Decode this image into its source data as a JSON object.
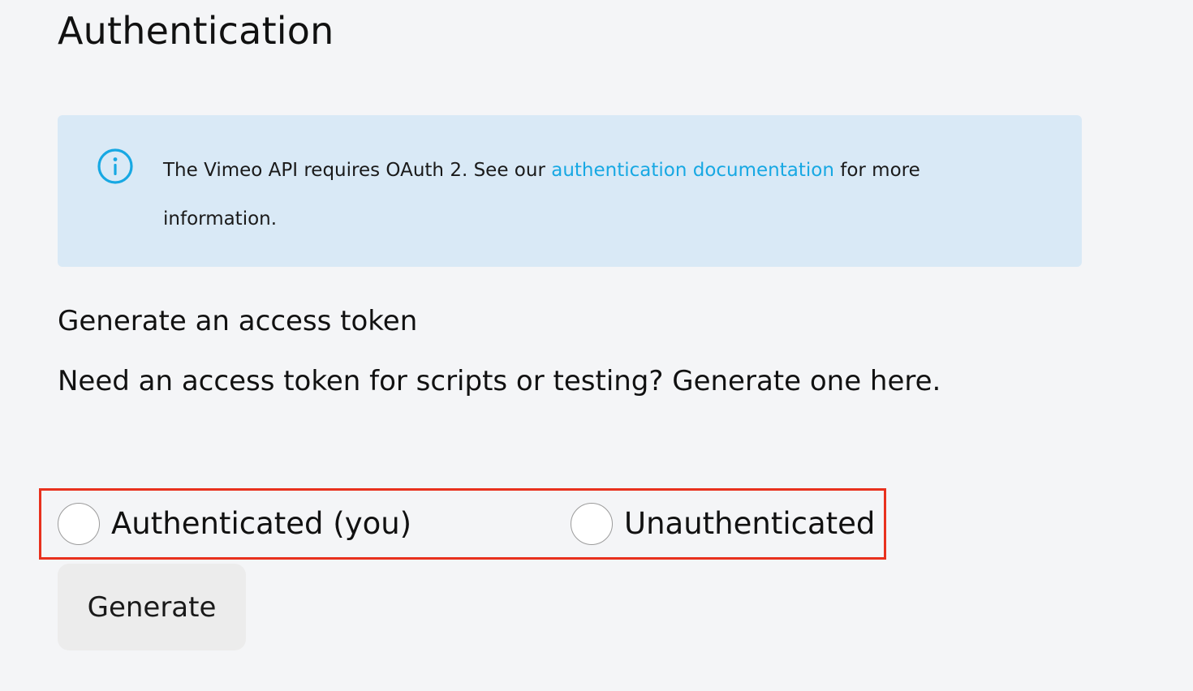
{
  "page": {
    "title": "Authentication"
  },
  "notice": {
    "icon": "info-icon",
    "accent_color": "#17a8e3",
    "background_color": "#d9e9f6",
    "text_before": "The Vimeo API requires OAuth 2. See our ",
    "link_text": "authentication documentation",
    "text_after": " for more information."
  },
  "token_section": {
    "heading": "Generate an access token",
    "description": "Need an access token for scripts or testing? Generate one here.",
    "options": [
      {
        "label": "Authenticated (you)",
        "selected": false
      },
      {
        "label": "Unauthenticated",
        "selected": false
      }
    ],
    "generate_label": "Generate",
    "highlight_color": "#e8311e"
  }
}
